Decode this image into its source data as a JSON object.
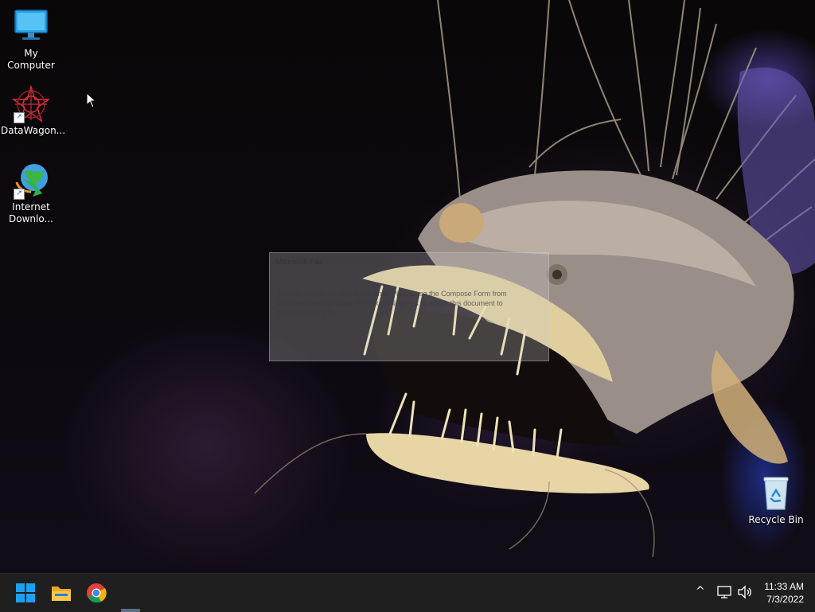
{
  "desktop": {
    "icons": [
      {
        "label": "My Computer",
        "icon": "monitor-icon"
      },
      {
        "label": "DataWagon...",
        "icon": "datawagon-star-icon"
      },
      {
        "label": "Internet Downlo...",
        "icon": "globe-download-icon"
      },
      {
        "label": "Recycle Bin",
        "icon": "recycle-bin-icon"
      }
    ]
  },
  "fax_dialog": {
    "title": "Microsoft Fax",
    "message": "This fax cannot be sent at this time. Please use the Compose Form from Windows Fax and Scan, or click on New Fax to attach this document to send it out as a fax."
  },
  "taskbar": {
    "items": [
      {
        "name": "start",
        "icon": "windows-logo-icon"
      },
      {
        "name": "file-explorer",
        "icon": "folder-icon"
      },
      {
        "name": "chrome",
        "icon": "chrome-icon"
      }
    ],
    "tray": {
      "chevron": "^",
      "network_icon": "network-icon",
      "volume_icon": "speaker-icon"
    },
    "clock": {
      "time": "11:33 AM",
      "date": "7/3/2022"
    }
  },
  "colors": {
    "taskbar_bg": "#1f1f1f",
    "accent_blue": "#1ba1f2"
  }
}
